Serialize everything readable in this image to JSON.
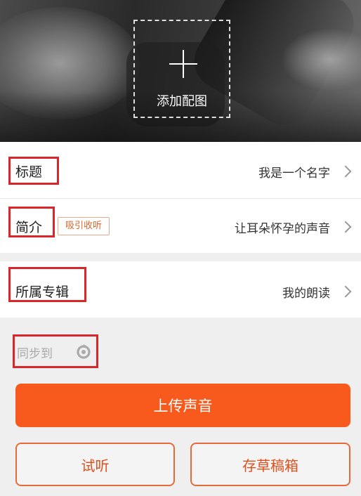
{
  "hero": {
    "add_image_label": "添加配图"
  },
  "fields": {
    "title": {
      "label": "标题",
      "value": "我是一个名字"
    },
    "intro": {
      "label": "简介",
      "badge": "吸引收听",
      "value": "让耳朵怀孕的声音"
    },
    "album": {
      "label": "所属专辑",
      "value": "我的朗读"
    }
  },
  "sync": {
    "label": "同步到"
  },
  "actions": {
    "upload_label": "上传声音",
    "preview_label": "试听",
    "draft_label": "存草稿箱"
  },
  "colors": {
    "accent": "#f85a1e",
    "highlight": "#d9262b",
    "badge_text": "#d9662e"
  }
}
